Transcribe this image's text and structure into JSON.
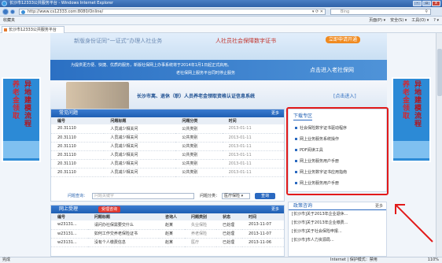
{
  "window": {
    "title": "长沙市12333公共服务平台 - Windows Internet Explorer"
  },
  "address": {
    "url": "http://www.cs12333.com:8080/Online/",
    "search_placeholder": "Bing"
  },
  "favorites": {
    "label": "收藏夹",
    "tools": [
      "页面(P) ▾",
      "安全(S) ▾",
      "工具(O) ▾",
      "? ▾"
    ]
  },
  "tab": {
    "label": "长沙市12333公共服务平台"
  },
  "banner": {
    "line1": "新版身份证同“一证式”办理人社业务",
    "line1b": "人社员社会保障数字证书",
    "apply": "立即申请开通",
    "line2": "为提供更方便、快捷、优质的服务，新版社保网上办事系统将于2014年1月1日起正式启用。",
    "line3": "老社保网上服务平台同时停止服务",
    "cta": "点击进入老社保网",
    "title3": "长沙市离、退休（职）人员养老金领取资格认证信息系统",
    "link3": "[点击进入]"
  },
  "side_left": {
    "col1": "养老金领取",
    "col2": "异地建模流程"
  },
  "side_right": {
    "col1": "养老金领取",
    "col2": "异地建模流程"
  },
  "faq": {
    "title": "常见问题",
    "more": "更多",
    "headers": [
      "编号",
      "问题标题",
      "问题分类",
      "时间"
    ],
    "rows": [
      [
        "20.31110",
        "人员减少相关问",
        "公共类别",
        "2013-01-11"
      ],
      [
        "20.31110",
        "人员减少相关问",
        "公共类别",
        "2013-01-11"
      ],
      [
        "20.31110",
        "人员减少相关问",
        "公共类别",
        "2013-01-11"
      ],
      [
        "20.31110",
        "人员减少相关问",
        "公共类别",
        "2013-01-11"
      ],
      [
        "20.31110",
        "人员减少相关问",
        "公共类别",
        "2013-01-11"
      ],
      [
        "20.31110",
        "人员减少相关问",
        "公共类别",
        "2013-01-11"
      ]
    ]
  },
  "query": {
    "label": "问题查询：",
    "placeholder": "问题关键字",
    "type_label": "问题分类：",
    "type_value": "医疗保险 ▾",
    "go": "查询"
  },
  "downloads": {
    "title": "下载专区",
    "items": [
      "社会保险数字证书驱动程序",
      "网上业务服务系统操作",
      "PDF阅读工具",
      "网上业务服务用户手册",
      "网上业务数字证书应用指南",
      "网上业务服务用户手册"
    ]
  },
  "online": {
    "title": "网上受理",
    "badge": "受理咨询",
    "more": "更多",
    "headers": [
      "编号",
      "问题标题",
      "咨询人",
      "问题类别",
      "状态",
      "时间"
    ],
    "rows": [
      [
        "w23131...",
        "请问办社保需要交什么",
        "赵某",
        "失业保险",
        "已处理",
        "2013-11-07"
      ],
      [
        "w23131...",
        "如何工作交养老保险证书",
        "赵某",
        "养老保险",
        "已处理",
        "2013-11-07"
      ],
      [
        "w23131...",
        "没有个人缴费信息",
        "赵某",
        "医疗",
        "已处理",
        "2013-11-06"
      ]
    ]
  },
  "policy": {
    "title": "政策咨询",
    "more": "更多",
    "items": [
      "[长沙市]关于2013年企业退休...",
      "[长沙市]关于2013年企业缴费...",
      "[长沙市]关于社会保险申报...",
      "[长沙市]市人力资源局..."
    ]
  },
  "status": {
    "left": "完成",
    "zone": "Internet | 保护模式：禁用",
    "zoom": "110%"
  }
}
